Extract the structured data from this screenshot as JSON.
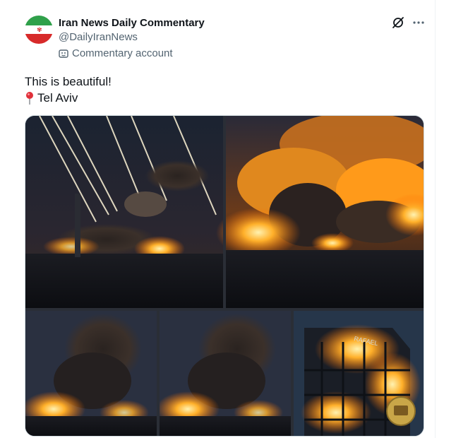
{
  "post": {
    "author_name": "Iran News Daily Commentary",
    "author_handle": "@DailyIranNews",
    "account_label": "Commentary account",
    "text_line1": "This is beautiful!",
    "location_text": "Tel Aviv"
  },
  "media": {
    "sign_text": "RAFAEL",
    "panels": 5
  },
  "icons": {
    "grok": "grok-icon",
    "more": "more-icon",
    "label": "commentary-badge-icon",
    "location": "round-pushpin-icon"
  },
  "colors": {
    "text": "#0f1419",
    "secondary": "#536471",
    "fire": "#ff8a1a",
    "border": "#cfd9de"
  }
}
